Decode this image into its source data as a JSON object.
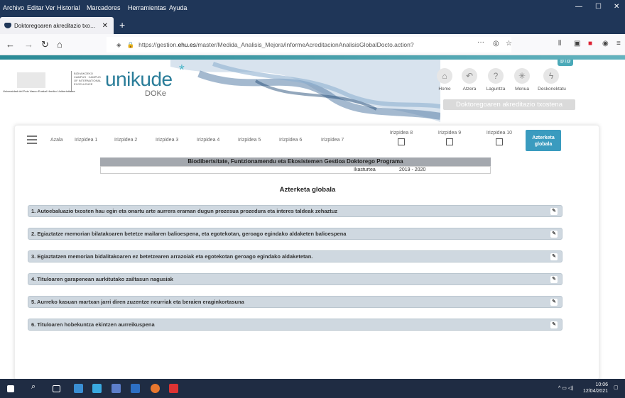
{
  "browser": {
    "menu": [
      "Archivo",
      "Editar",
      "Ver",
      "Historial",
      "Marcadores",
      "Herramientas",
      "Ayuda"
    ],
    "tab_title": "Doktoregoaren akreditazio txo…",
    "url_prefix": "https://gestion.",
    "url_domain": "ehu.es",
    "url_rest": "/master/Medida_Analisis_Mejora/informeAcreditacionAnalisisGlobalDocto.action?",
    "more_glyph": "···"
  },
  "header": {
    "university_line": "Universidad del País Vasco   Euskal Herriko Unibertsitatea",
    "campus_lines": "BIZKAIKOEKO CAMPUS · CAMPUS OF INTERNATIONAL EXCELLENCE",
    "brand": "unikude",
    "brand_star": "*",
    "brand_sub": "DOKe",
    "badge": "@1@",
    "nav_icons": [
      {
        "label": "Home",
        "icon": "home-icon"
      },
      {
        "label": "Atzera",
        "icon": "back-icon"
      },
      {
        "label": "Laguntza",
        "icon": "help-icon"
      },
      {
        "label": "Menua",
        "icon": "menu-icon"
      },
      {
        "label": "Deskonektatu",
        "icon": "disconnect-icon"
      }
    ],
    "report_button": "Doktoregoaren akreditazio txostena"
  },
  "tabs": {
    "plain": [
      "Azala",
      "Irizpidea 1",
      "Irizpidea 2",
      "Irizpidea 3",
      "Irizpidea 4",
      "Irizpidea 5",
      "Irizpidea 6",
      "Irizpidea 7"
    ],
    "checkbox": [
      "Irizpidea 8",
      "Irizpidea 9",
      "Irizpidea 10"
    ],
    "active": [
      "Azterketa",
      "globala"
    ]
  },
  "program": {
    "title": "Biodibertsitate, Funtzionamendu eta Ekosistemen Gestioa Doktorego Programa",
    "year_label": "Ikasturtea",
    "year_value": "2019 - 2020"
  },
  "section_title": "Azterketa globala",
  "sections": [
    "1. Autoebaluazio txosten hau egin eta onartu arte aurrera eraman dugun prozesua prozedura eta interes taldeak zehaztuz",
    "2. Egiaztatze memorian bilatakoaren betetze mailaren balioespena, eta egotekotan, geroago egindako aldaketen balioespena",
    "3. Egiaztatzen memorian bidalitakoaren ez betetzearen arrazoiak eta egotekotan geroago egindako aldaketetan.",
    "4. Tituloaren garapenean aurkitutako zailtasun nagusiak",
    "5. Aurreko kasuan martxan jarri diren zuzentze neurriak eta beraien eraginkortasuna",
    "6. Tituloaren hobekuntza ekintzen aurreikuspena"
  ],
  "taskbar": {
    "time": "10:06",
    "date": "12/04/2021"
  },
  "colors": {
    "accent": "#3a9bbf",
    "section_bg": "#cfd8e0",
    "brand": "#2a7d99"
  }
}
